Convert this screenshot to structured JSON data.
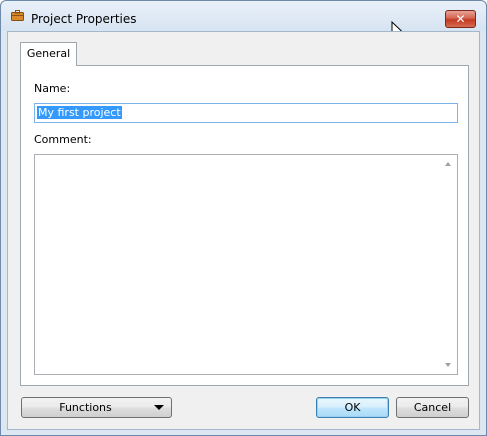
{
  "window": {
    "title": "Project Properties",
    "close_glyph": "✕",
    "icon": "briefcase-icon"
  },
  "tabs": [
    {
      "label": "General",
      "selected": true
    }
  ],
  "form": {
    "name_label": "Name:",
    "name_value": "My first project",
    "comment_label": "Comment:",
    "comment_value": ""
  },
  "buttons": {
    "functions_label": "Functions",
    "ok_label": "OK",
    "cancel_label": "Cancel"
  },
  "colors": {
    "selection": "#3399ff",
    "close_button": "#c13a22",
    "default_button_border": "#3c7fb1"
  }
}
